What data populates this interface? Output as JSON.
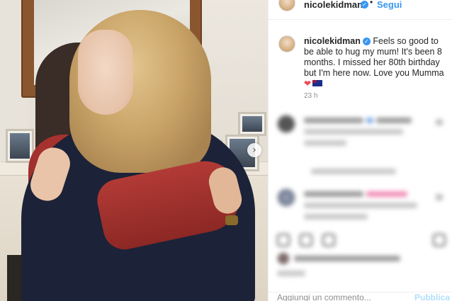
{
  "post": {
    "username": "nicolekidman",
    "verified_icon": "verified-badge-icon",
    "follow_label": "Segui",
    "separator": "•",
    "caption": "Feels so good to be able to hug my mum! It's been 8 months. I missed her 80th birthday but I'm here now. Love you Mumma",
    "caption_emojis": [
      "red-heart",
      "australia-flag"
    ],
    "heart_glyph": "❤",
    "time_ago": "23 h"
  },
  "comment_box": {
    "placeholder": "Aggiungi un commento...",
    "publish_label": "Pubblica"
  },
  "photo": {
    "next_glyph": "›"
  },
  "colors": {
    "accent": "#3897f0",
    "verified": "#3897f0",
    "publish_disabled": "#b2dffc",
    "heart": "#ed4956"
  }
}
